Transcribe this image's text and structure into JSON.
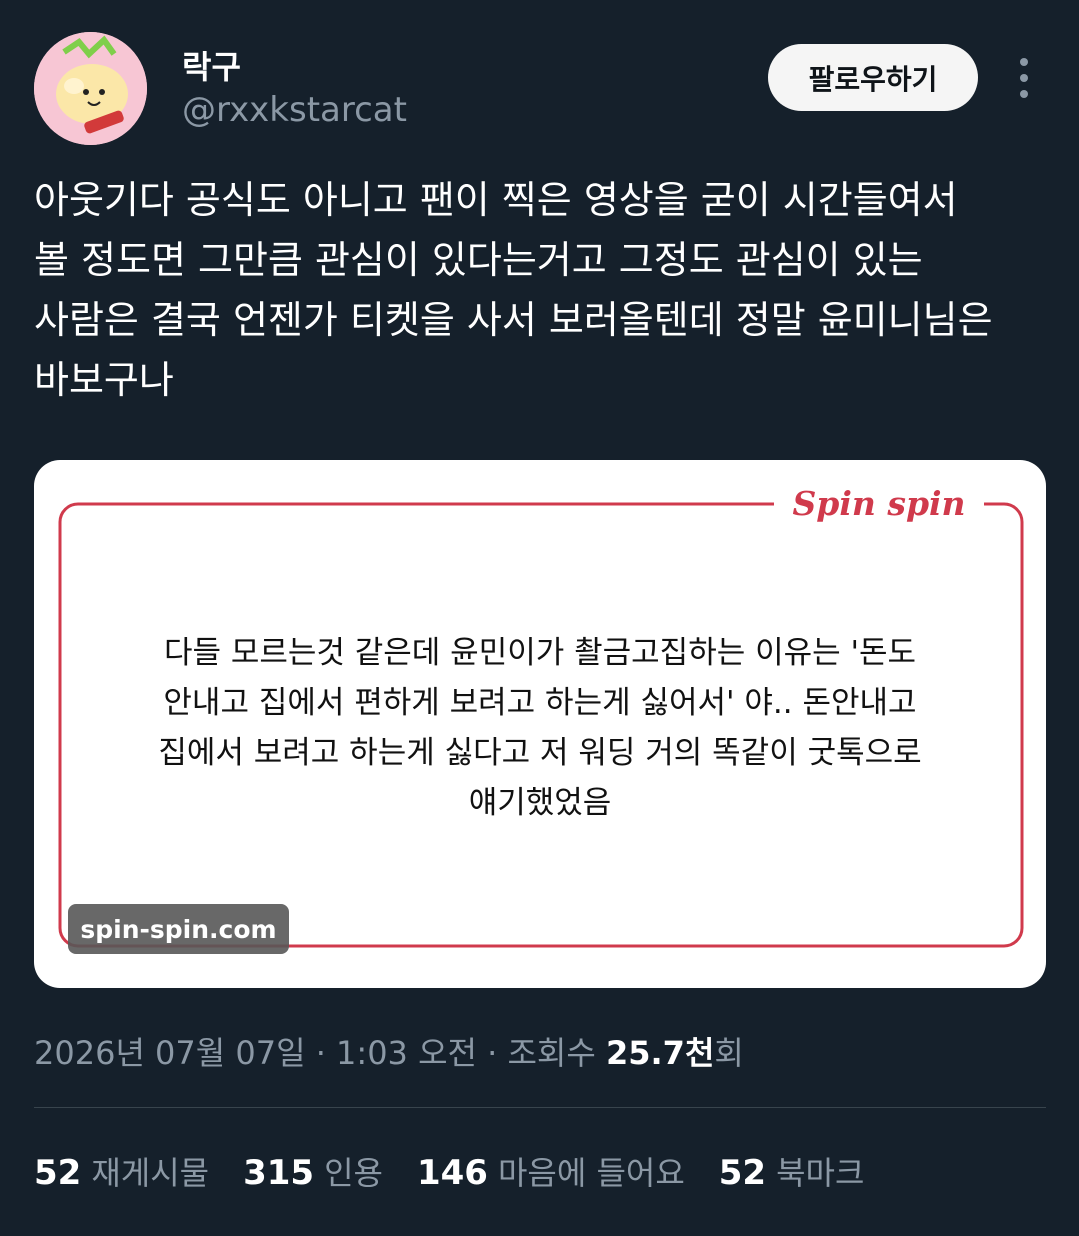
{
  "author": {
    "display_name": "락구",
    "handle": "@rxxkstarcat"
  },
  "header": {
    "follow_label": "팔로우하기",
    "more_icon": "more-vertical-icon"
  },
  "tweet": {
    "text_lines": [
      "아웃기다 공식도 아니고 팬이 찍은 영상을 굳이 시간들여서",
      "볼 정도면 그만큼 관심이 있다는거고 그정도 관심이 있는",
      "사람은 결국 언젠가 티켓을 사서 보러올텐데 정말 윤미니님은",
      "바보구나"
    ]
  },
  "media": {
    "logo_text": "Spin spin",
    "quote_lines": [
      "다들 모르는것 같은데 윤민이가 촬금고집하는 이유는 '돈도",
      "안내고 집에서 편하게 보려고 하는게 싫어서' 야.. 돈안내고",
      "집에서 보려고 하는게 싫다고 저 워딩 거의 똑같이 굿톡으로",
      "얘기했었음"
    ],
    "watermark": "spin-spin.com",
    "accent_color": "#d03a4c"
  },
  "meta": {
    "datetime": "2026년 07월 07일 · 1:03 오전 · 조회수 ",
    "views": "25.7천",
    "views_suffix": "회"
  },
  "stats": [
    {
      "count": "52",
      "label": "재게시물"
    },
    {
      "count": "315",
      "label": "인용"
    },
    {
      "count": "146",
      "label": "마음에 들어요"
    },
    {
      "count": "52",
      "label": "북마크"
    }
  ]
}
